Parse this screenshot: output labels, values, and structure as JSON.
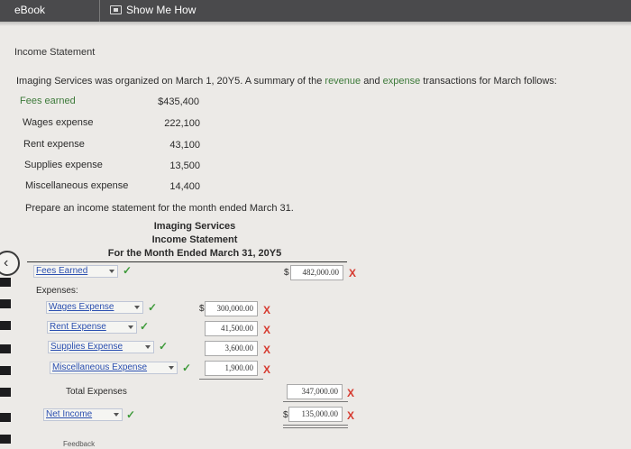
{
  "topbar": {
    "ebook_label": "eBook",
    "show_me_how_label": "Show Me How"
  },
  "section_title": "Income Statement",
  "intro": {
    "before": "Imaging Services was organized on March 1, 20Y5. A summary of the ",
    "revenue_word": "revenue",
    "middle": " and ",
    "expense_word": "expense",
    "after": " transactions for March follows:"
  },
  "summary": [
    {
      "label": "Fees earned",
      "value": "$435,400"
    },
    {
      "label": "Wages expense",
      "value": "222,100"
    },
    {
      "label": "Rent expense",
      "value": "43,100"
    },
    {
      "label": "Supplies expense",
      "value": "13,500"
    },
    {
      "label": "Miscellaneous expense",
      "value": "14,400"
    }
  ],
  "instruction": "Prepare an income statement for the month ended March 31.",
  "statement": {
    "company": "Imaging Services",
    "name": "Income Statement",
    "period": "For the Month Ended March 31, 20Y5",
    "revenue_select": "Fees Earned",
    "revenue_amount": "482,000.00",
    "expenses_label": "Expenses:",
    "expense_rows": [
      {
        "select": "Wages Expense",
        "amount": "300,000.00"
      },
      {
        "select": "Rent Expense",
        "amount": "41,500.00"
      },
      {
        "select": "Supplies Expense",
        "amount": "3,600.00"
      },
      {
        "select": "Miscellaneous Expense",
        "amount": "1,900.00"
      }
    ],
    "total_label": "Total Expenses",
    "total_amount": "347,000.00",
    "net_select": "Net Income",
    "net_amount": "135,000.00",
    "dollar_sign": "$"
  },
  "marks": {
    "check": "✓",
    "cross": "X"
  },
  "feedback_label": "Feedback",
  "colors": {
    "correct": "#3e9a3a",
    "incorrect": "#d63a2f",
    "link": "#2b4fb0",
    "topbar": "#4a4a4c"
  }
}
